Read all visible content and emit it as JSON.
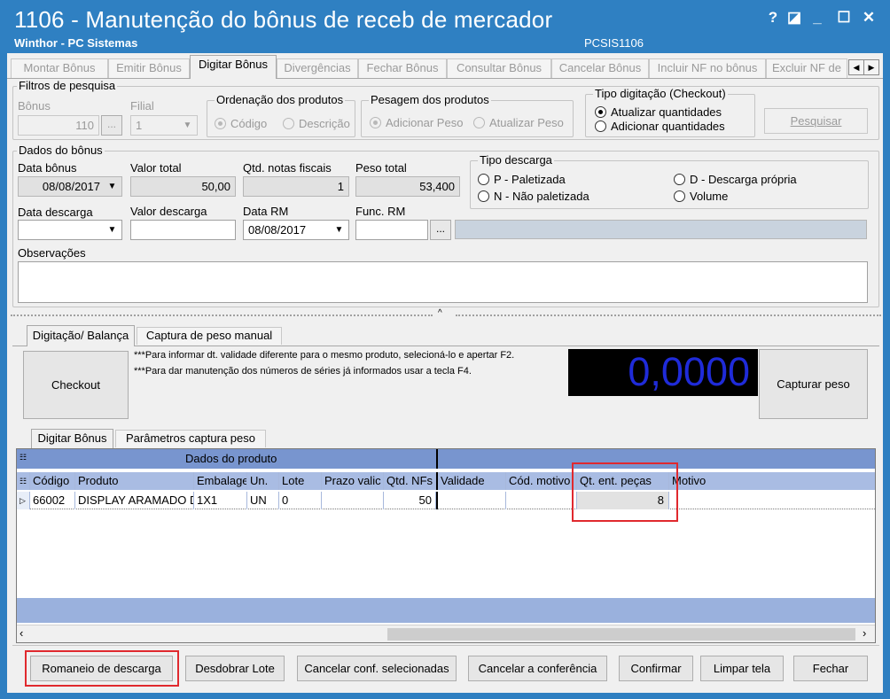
{
  "window": {
    "title": "1106 - Manutenção do bônus de receb de mercador",
    "company": "Winthor - PC Sistemas",
    "code": "PCSIS1106",
    "help": "?",
    "restore": "◪",
    "minimize": "_",
    "maximize": "☐",
    "close": "✕"
  },
  "tabs": [
    "Montar Bônus",
    "Emitir Bônus",
    "Digitar Bônus",
    "Divergências",
    "Fechar Bônus",
    "Consultar Bônus",
    "Cancelar Bônus",
    "Incluir NF no bônus",
    "Excluir NF de"
  ],
  "filters": {
    "legend": "Filtros de pesquisa",
    "bonus_label": "Bônus",
    "bonus_value": "110",
    "filial_label": "Filial",
    "filial_value": "1",
    "ordenacao_legend": "Ordenação dos produtos",
    "ordenacao_options": [
      "Código",
      "Descrição"
    ],
    "pesagem_legend": "Pesagem dos produtos",
    "pesagem_options": [
      "Adicionar Peso",
      "Atualizar Peso"
    ],
    "tipo_legend": "Tipo digitação (Checkout)",
    "tipo_options": [
      "Atualizar quantidades",
      "Adicionar quantidades"
    ],
    "search_button": "Pesquisar"
  },
  "dados": {
    "legend": "Dados do bônus",
    "data_bonus_label": "Data bônus",
    "data_bonus_value": "08/08/2017",
    "valor_total_label": "Valor total",
    "valor_total_value": "50,00",
    "qtd_notas_label": "Qtd. notas fiscais",
    "qtd_notas_value": "1",
    "peso_total_label": "Peso total",
    "peso_total_value": "53,400",
    "tipo_descarga_legend": "Tipo descarga",
    "tipo_descarga_options": [
      "P - Paletizada",
      "N - Não paletizada",
      "D - Descarga própria",
      "Volume"
    ],
    "data_descarga_label": "Data descarga",
    "valor_descarga_label": "Valor descarga",
    "data_rm_label": "Data RM",
    "data_rm_value": "08/08/2017",
    "func_rm_label": "Func. RM",
    "observacoes_label": "Observações"
  },
  "lower_tabs": [
    "Digitação/ Balança",
    "Captura de peso manual"
  ],
  "balanca": {
    "checkout_button": "Checkout",
    "info_line1": "***Para informar dt. validade diferente para o mesmo produto, selecioná-lo e apertar F2.",
    "info_line2": "***Para dar manutenção dos números de séries já informados  usar a tecla F4.",
    "weight_display": "0,0000",
    "capture_button": "Capturar peso"
  },
  "inner_tabs": [
    "Digitar Bônus",
    "Parâmetros captura peso"
  ],
  "grid": {
    "band_label": "Dados do produto",
    "columns": [
      "Código",
      "Produto",
      "Embalage",
      "Un.",
      "Lote",
      "Prazo valic",
      "Qtd. NFs",
      "Validade",
      "Cód. motivo",
      "Qt. ent. peças",
      "Motivo"
    ],
    "rows": [
      [
        "66002",
        "DISPLAY ARAMADO D",
        "1X1",
        "UN",
        "0",
        "",
        "50",
        "",
        "",
        "8",
        ""
      ]
    ]
  },
  "bottom_buttons": [
    "Romaneio de descarga",
    "Desdobrar Lote",
    "Cancelar conf. selecionadas",
    "Cancelar a conferência",
    "Confirmar",
    "Limpar tela",
    "Fechar"
  ],
  "colors": {
    "window_blue": "#2f80c2",
    "grid_header_blue": "#7895cf",
    "grid_empty_blue": "#9ab1dd",
    "highlight_red": "#e0292e",
    "display_digits": "#1f2bd9"
  }
}
